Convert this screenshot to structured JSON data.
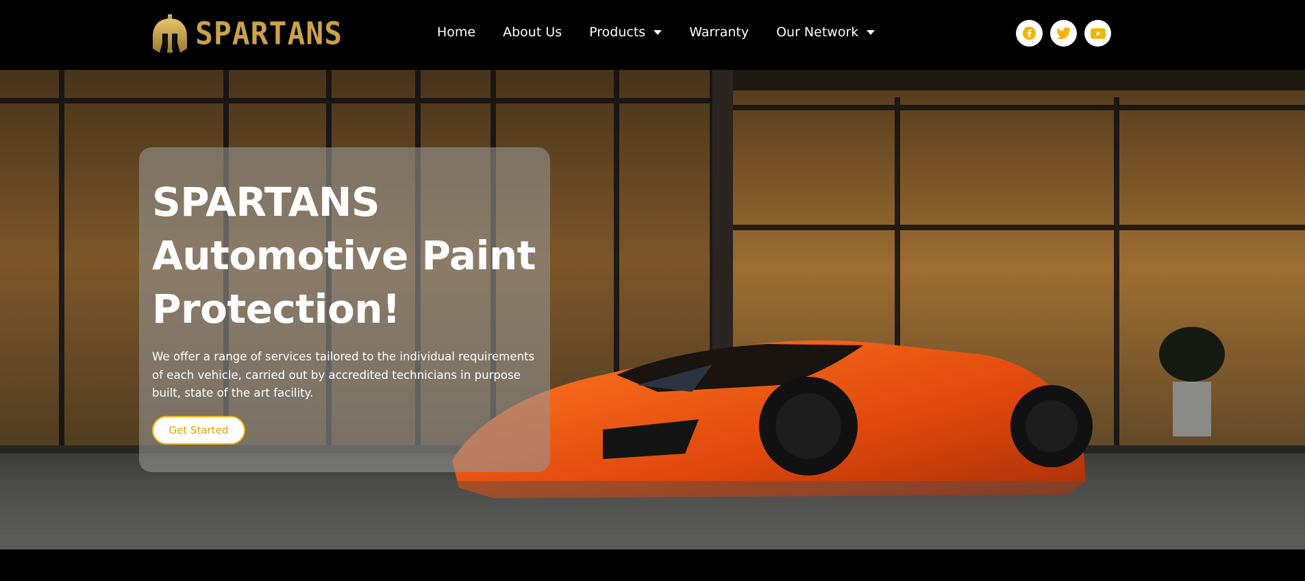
{
  "brand": {
    "name": "SPARTANS",
    "accent_color": "#c9a24a",
    "icon": "spartan-helmet-icon"
  },
  "nav": {
    "items": [
      {
        "label": "Home",
        "dropdown": false
      },
      {
        "label": "About Us",
        "dropdown": false
      },
      {
        "label": "Products",
        "dropdown": true
      },
      {
        "label": "Warranty",
        "dropdown": false
      },
      {
        "label": "Our Network",
        "dropdown": true
      }
    ]
  },
  "socials": [
    {
      "icon": "facebook-icon",
      "color": "#f4b400"
    },
    {
      "icon": "twitter-icon",
      "color": "#f4b400"
    },
    {
      "icon": "youtube-icon",
      "color": "#f4b400"
    }
  ],
  "hero": {
    "title_line1": "SPARTANS",
    "title_line2": "Automotive Paint",
    "title_line3": "Protection!",
    "description": "We offer a range of services tailored to the individual requirements of each vehicle, carried out by accredited technicians in purpose built, state of the art facility.",
    "cta_label": "Get Started",
    "background": "orange-sports-car-photo"
  }
}
